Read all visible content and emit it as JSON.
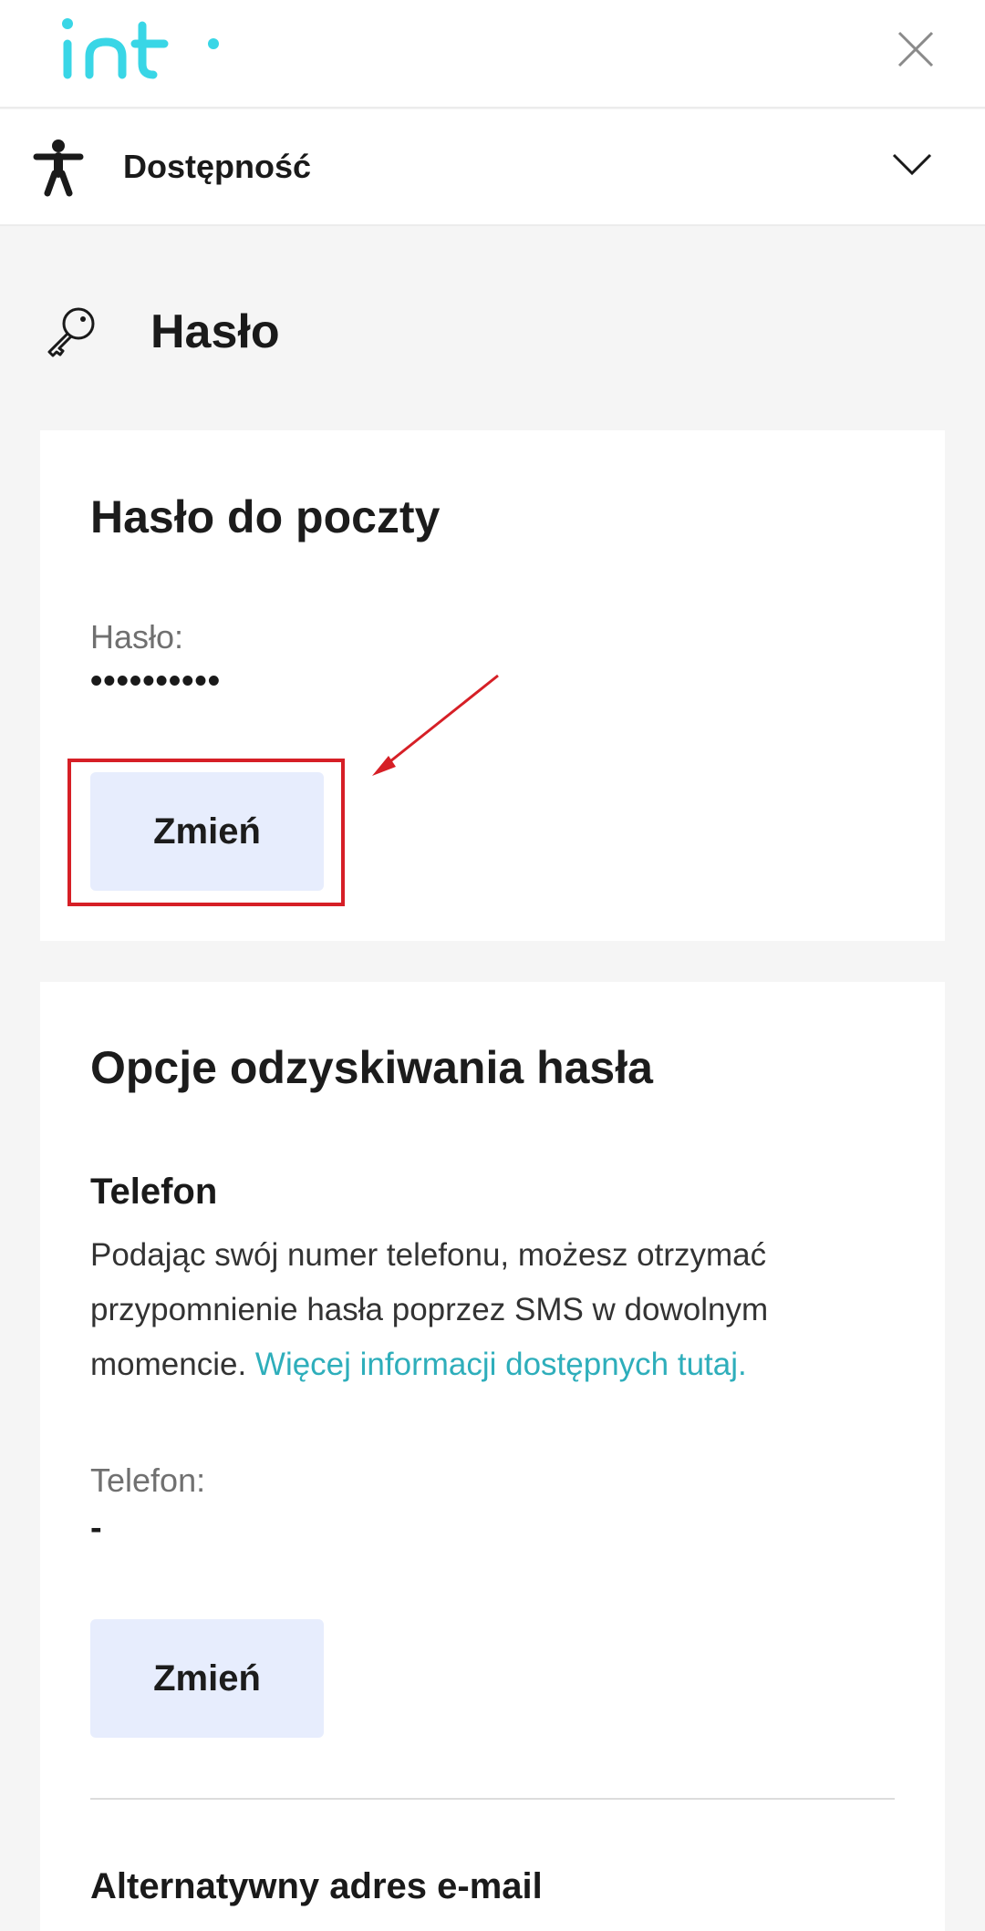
{
  "header": {
    "logo_alt": "int",
    "accessibility_label": "Dostępność"
  },
  "section": {
    "title": "Hasło"
  },
  "password_card": {
    "title": "Hasło do poczty",
    "field_label": "Hasło:",
    "field_value": "••••••••••",
    "change_button": "Zmień"
  },
  "recovery_card": {
    "title": "Opcje odzyskiwania hasła",
    "phone": {
      "heading": "Telefon",
      "description": "Podając swój numer telefonu, możesz otrzymać przypomnienie hasła poprzez SMS w dowolnym momencie. ",
      "more_link": "Więcej informacji dostępnych tutaj.",
      "field_label": "Telefon:",
      "field_value": "-",
      "change_button": "Zmień"
    },
    "alt_email": {
      "heading": "Alternatywny adres e-mail"
    }
  },
  "colors": {
    "brand": "#39d6e6",
    "button_bg": "#e7edfd",
    "link": "#2eaebb",
    "highlight": "#d61f26"
  },
  "icons": {
    "close": "close-icon",
    "accessibility": "accessibility-person-icon",
    "chevron": "chevron-down-icon",
    "key": "key-icon"
  }
}
